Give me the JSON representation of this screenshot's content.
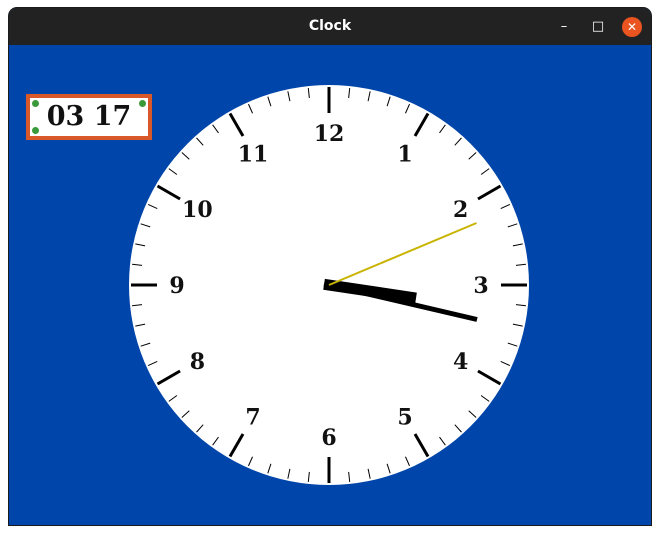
{
  "window": {
    "title": "Clock"
  },
  "titlebar_buttons": {
    "minimize": "–",
    "maximize": "□",
    "close": "✕"
  },
  "digital_clock": {
    "time_text": "03 17"
  },
  "clock_face": {
    "numerals": [
      "12",
      "1",
      "2",
      "3",
      "4",
      "5",
      "6",
      "7",
      "8",
      "9",
      "10",
      "11"
    ]
  },
  "time": {
    "hours": 3,
    "minutes": 17,
    "seconds": 11.2
  },
  "colors": {
    "background": "#0045aa",
    "titlebar": "#222222",
    "frame": "#d9582a",
    "face": "#ffffff",
    "second_hand": "#c8b400",
    "hands": "#000000",
    "corner_dots": "#3a9a3a"
  },
  "icons": {
    "minimize": "minimize-icon",
    "maximize": "maximize-icon",
    "close": "close-icon"
  }
}
